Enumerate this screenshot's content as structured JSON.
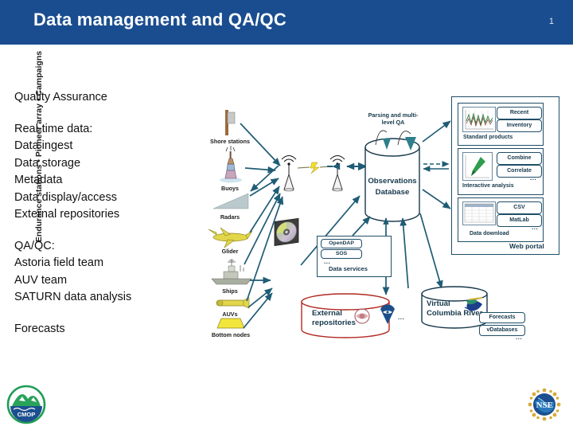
{
  "header": {
    "title": "Data management and QA/QC",
    "page_number": "1"
  },
  "left_column": {
    "heading": "Quality Assurance",
    "section1_title": "Real-time data:",
    "section1_items": [
      "Data ingest",
      "Data storage",
      "Metadata",
      "Data display/access",
      "External repositories"
    ],
    "section2_title": "QA/QC:",
    "section2_items": [
      "Astoria field team",
      "AUV team",
      "SATURN data analysis"
    ],
    "section3_title": "Forecasts"
  },
  "diagram": {
    "vertical_label": "Endurance stations • Pioneer array • Campaigns",
    "platforms": [
      {
        "label": "Shore stations",
        "icon": "shore-station-icon"
      },
      {
        "label": "Buoys",
        "icon": "buoy-icon"
      },
      {
        "label": "Radars",
        "icon": "radar-icon"
      },
      {
        "label": "Glider",
        "icon": "glider-icon"
      },
      {
        "label": "Ships",
        "icon": "ship-icon"
      },
      {
        "label": "AUVs",
        "icon": "auv-icon"
      },
      {
        "label": "Bottom nodes",
        "icon": "bottom-node-icon"
      }
    ],
    "qa_note": "Parsing and multi-\nlevel QA",
    "qa_note_line1": "Parsing and multi-",
    "qa_note_line2": "level QA",
    "observations_db_line1": "Observations",
    "observations_db_line2": "Database",
    "data_services": {
      "caption": "Data services",
      "items": [
        "OpenDAP",
        "SOS"
      ],
      "ellipsis": "..."
    },
    "external_repositories_line1": "External",
    "external_repositories_line2": "repositories",
    "external_repositories_ellipsis": "...",
    "virtual_columbia_line1": "Virtual",
    "virtual_columbia_line2": "Columbia River",
    "virtual_columbia_buttons": [
      "Forecasts",
      "vDatabases"
    ],
    "virtual_columbia_ellipsis": "...",
    "web_portal": {
      "caption": "Web portal",
      "cards": [
        {
          "caption": "Standard products",
          "buttons": [
            "Recent",
            "Inventory"
          ],
          "ellipsis": "",
          "thumb": "timeseries-plot-thumb"
        },
        {
          "caption": "Interactive analysis",
          "buttons": [
            "Combine",
            "Correlate"
          ],
          "ellipsis": "...",
          "thumb": "map-plot-thumb"
        },
        {
          "caption": "Data download",
          "buttons": [
            "CSV",
            "MatLab"
          ],
          "ellipsis": "...",
          "thumb": "table-thumb"
        }
      ]
    }
  },
  "logos": {
    "left": "cmop-logo",
    "left_text": "CMOP",
    "right": "nsf-logo",
    "right_text": "NSF"
  },
  "colors": {
    "header_blue": "#1a4d8f",
    "arrow_teal": "#1f5c75",
    "outline_teal": "#1f4e68",
    "repo_red": "#b02a22",
    "platform_yellow": "#e8d94a"
  }
}
